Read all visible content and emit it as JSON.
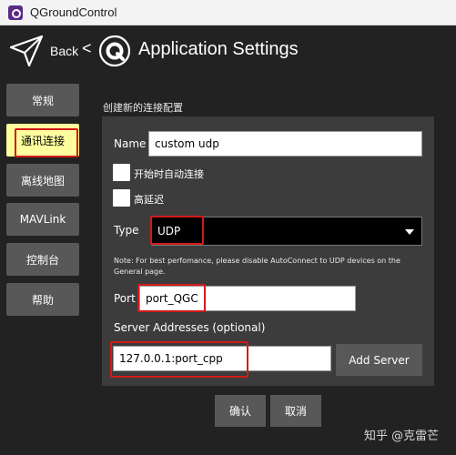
{
  "window": {
    "title": "QGroundControl"
  },
  "header": {
    "back_label": "Back",
    "back_chevron": "<",
    "title": "Application Settings",
    "icons": [
      "paper-plane-icon",
      "qgc-logo-icon"
    ]
  },
  "sidebar": {
    "items": [
      {
        "label": "常规"
      },
      {
        "label": "通讯连接",
        "active": true
      },
      {
        "label": "离线地图"
      },
      {
        "label": "MAVLink"
      },
      {
        "label": "控制台"
      },
      {
        "label": "帮助"
      }
    ]
  },
  "form": {
    "section_title": "创建新的连接配置",
    "name_label": "Name",
    "name_value": "custom udp",
    "auto_connect_label": "开始时自动连接",
    "high_latency_label": "高延迟",
    "type_label": "Type",
    "type_value": "UDP",
    "note": "Note: For best perfomance, please disable AutoConnect to UDP devices on the General page.",
    "port_label": "Port",
    "port_value": "port_QGC",
    "server_addresses_label": "Server Addresses (optional)",
    "server_address_value": "127.0.0.1:port_cpp",
    "add_server_label": "Add Server"
  },
  "buttons": {
    "confirm": "确认",
    "cancel": "取消"
  },
  "watermark": "知乎 @克雷芒",
  "colors": {
    "active_tab": "#ffff9e",
    "highlight": "#d11a1a",
    "button": "#585858",
    "background": "#222222",
    "panel": "#3c3c3c"
  }
}
